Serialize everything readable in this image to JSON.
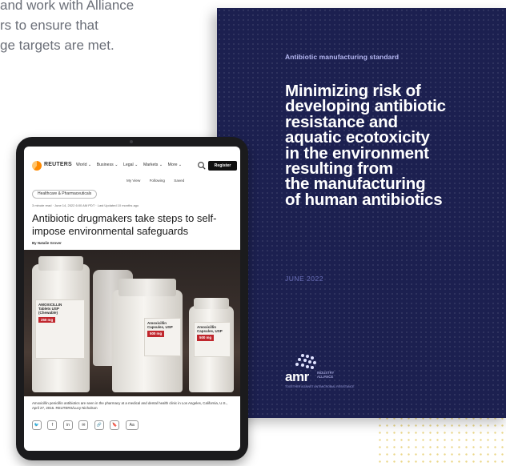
{
  "intro": {
    "lines": [
      "and work with Alliance",
      "rs to ensure that",
      "ge targets are met."
    ]
  },
  "cover": {
    "kicker": "Antibiotic manufacturing standard",
    "title_lines": [
      "Minimizing risk of",
      "developing antibiotic",
      "resistance and",
      "aquatic ecotoxicity",
      "in the environment",
      "resulting from",
      "the manufacturing",
      "of human antibiotics"
    ],
    "date": "JUNE 2022",
    "logo": {
      "wordmark": "amr",
      "sub": "INDUSTRY ALLIANCE",
      "tagline": "TOGETHER AGAINST ANTIMICROBIAL RESISTANCE"
    },
    "colors": {
      "background": "#1c2050",
      "kicker": "#b6b8f2",
      "title": "#ffffff"
    }
  },
  "article": {
    "brand": "REUTERS",
    "nav": [
      "World ⌄",
      "Business ⌄",
      "Legal ⌄",
      "Markets ⌄",
      "More ⌄"
    ],
    "register": "Register",
    "subnav": [
      "My View",
      "Following",
      "Saved"
    ],
    "tag": "Healthcare & Pharmaceuticals",
    "meta": "3 minute read · June 14, 2022 6:00 AM PDT · Last Updated 10 months ago",
    "headline": "Antibiotic drugmakers take steps to self-impose environmental safeguards",
    "byline": "By Natalie Grover",
    "photo_labels": {
      "left": [
        "AMOXICILLIN",
        "Tablets USP",
        "(Chewable)",
        "250 mg"
      ],
      "center": [
        "Amoxicillin",
        "Capsules, USP",
        "500 mg"
      ],
      "right": [
        "Amoxicillin",
        "Capsules, USP",
        "500 mg"
      ]
    },
    "caption": "Amoxicillin penicillin antibiotics are seen in the pharmacy at a medical and dental health clinic in Los Angeles, California, U.S., April 27, 2016. REUTERS/Lucy Nicholson",
    "share_icons": [
      "twitter-icon",
      "facebook-icon",
      "linkedin-icon",
      "email-icon",
      "link-icon",
      "bookmark-icon",
      "text-size-icon"
    ],
    "share_glyphs": [
      "🐦",
      "f",
      "in",
      "✉",
      "🔗",
      "🔖",
      "Aa"
    ]
  }
}
